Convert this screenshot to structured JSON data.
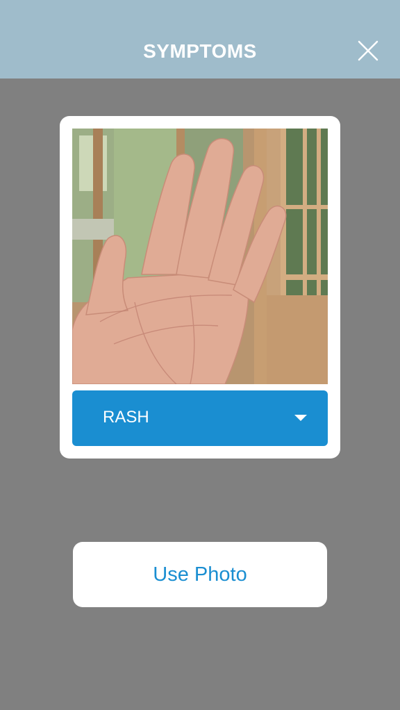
{
  "header": {
    "title": "SYMPTOMS",
    "close_icon": "close-icon"
  },
  "card": {
    "photo_subject": "open-palm-hand",
    "symptom_select": {
      "selected": "RASH",
      "icon": "chevron-down-icon"
    }
  },
  "actions": {
    "use_photo_label": "Use Photo"
  },
  "colors": {
    "header_bg": "#9fbccb",
    "page_bg": "#808080",
    "accent": "#1a8ed1",
    "card_bg": "#ffffff"
  }
}
